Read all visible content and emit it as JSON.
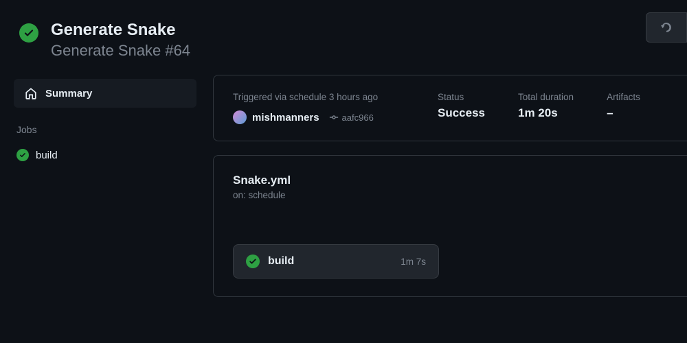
{
  "header": {
    "title": "Generate Snake",
    "subtitle": "Generate Snake #64"
  },
  "sidebar": {
    "summary_label": "Summary",
    "jobs_heading": "Jobs",
    "jobs": [
      {
        "name": "build"
      }
    ]
  },
  "meta": {
    "trigger_label": "Triggered via schedule 3 hours ago",
    "username": "mishmanners",
    "commit": "aafc966",
    "status_label": "Status",
    "status_value": "Success",
    "duration_label": "Total duration",
    "duration_value": "1m 20s",
    "artifacts_label": "Artifacts",
    "artifacts_value": "–"
  },
  "workflow": {
    "file": "Snake.yml",
    "on": "on: schedule",
    "job_name": "build",
    "job_time": "1m 7s"
  }
}
